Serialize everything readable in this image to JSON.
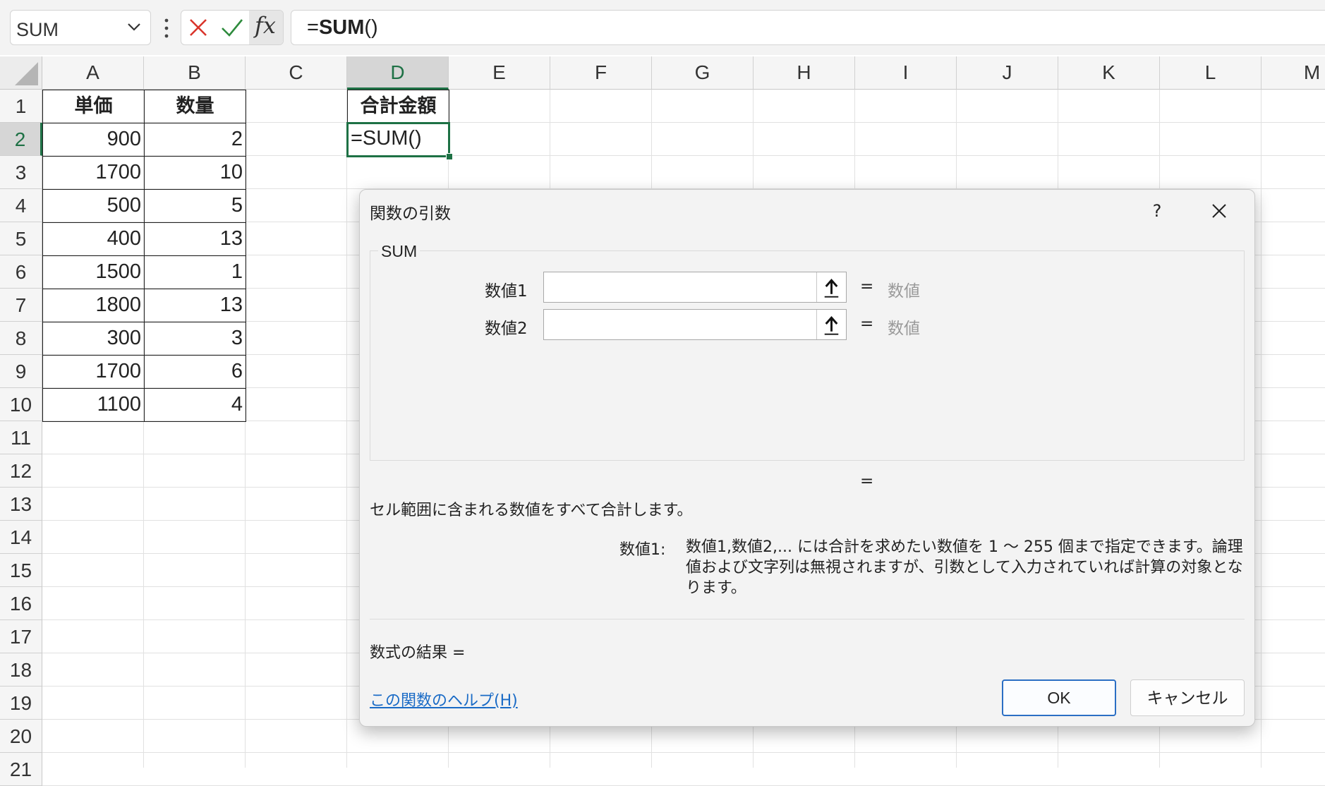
{
  "formula_bar": {
    "name_box": "SUM",
    "fx_label": "fx",
    "formula_prefix": "=",
    "formula_func": "SUM",
    "formula_suffix": "()"
  },
  "columns": [
    "A",
    "B",
    "C",
    "D",
    "E",
    "F",
    "G",
    "H",
    "I",
    "J",
    "K",
    "L",
    "M"
  ],
  "rows": [
    "1",
    "2",
    "3",
    "4",
    "5",
    "6",
    "7",
    "8",
    "9",
    "10",
    "11",
    "12",
    "13",
    "14",
    "15",
    "16",
    "17",
    "18",
    "19",
    "20",
    "21"
  ],
  "sheet": {
    "header_a": "単価",
    "header_b": "数量",
    "header_d": "合計金額",
    "unit_prices": [
      "900",
      "1700",
      "500",
      "400",
      "1500",
      "1800",
      "300",
      "1700",
      "1100"
    ],
    "quantities": [
      "2",
      "10",
      "5",
      "13",
      "1",
      "13",
      "3",
      "6",
      "4"
    ],
    "active_cell_value": "=SUM()"
  },
  "dialog": {
    "title": "関数の引数",
    "help_glyph": "?",
    "function_name": "SUM",
    "args": [
      {
        "label": "数値1",
        "value": "",
        "equals": "=",
        "hint": "数値"
      },
      {
        "label": "数値2",
        "value": "",
        "equals": "=",
        "hint": "数値"
      }
    ],
    "result_equals": "=",
    "description": "セル範囲に含まれる数値をすべて合計します。",
    "arg_desc_label": "数値1:",
    "arg_desc": "数値1,数値2,... には合計を求めたい数値を 1 ～ 255 個まで指定できます。論理値および文字列は無視されますが、引数として入力されていれば計算の対象となります。",
    "formula_result": "数式の結果 =",
    "help_link": "この関数のヘルプ(H)",
    "ok_label": "OK",
    "cancel_label": "キャンセル"
  },
  "colors": {
    "accent_green": "#1e7145",
    "link_blue": "#1a6bc6",
    "cancel_red": "#d9342b",
    "enter_green": "#2e8b3d"
  }
}
